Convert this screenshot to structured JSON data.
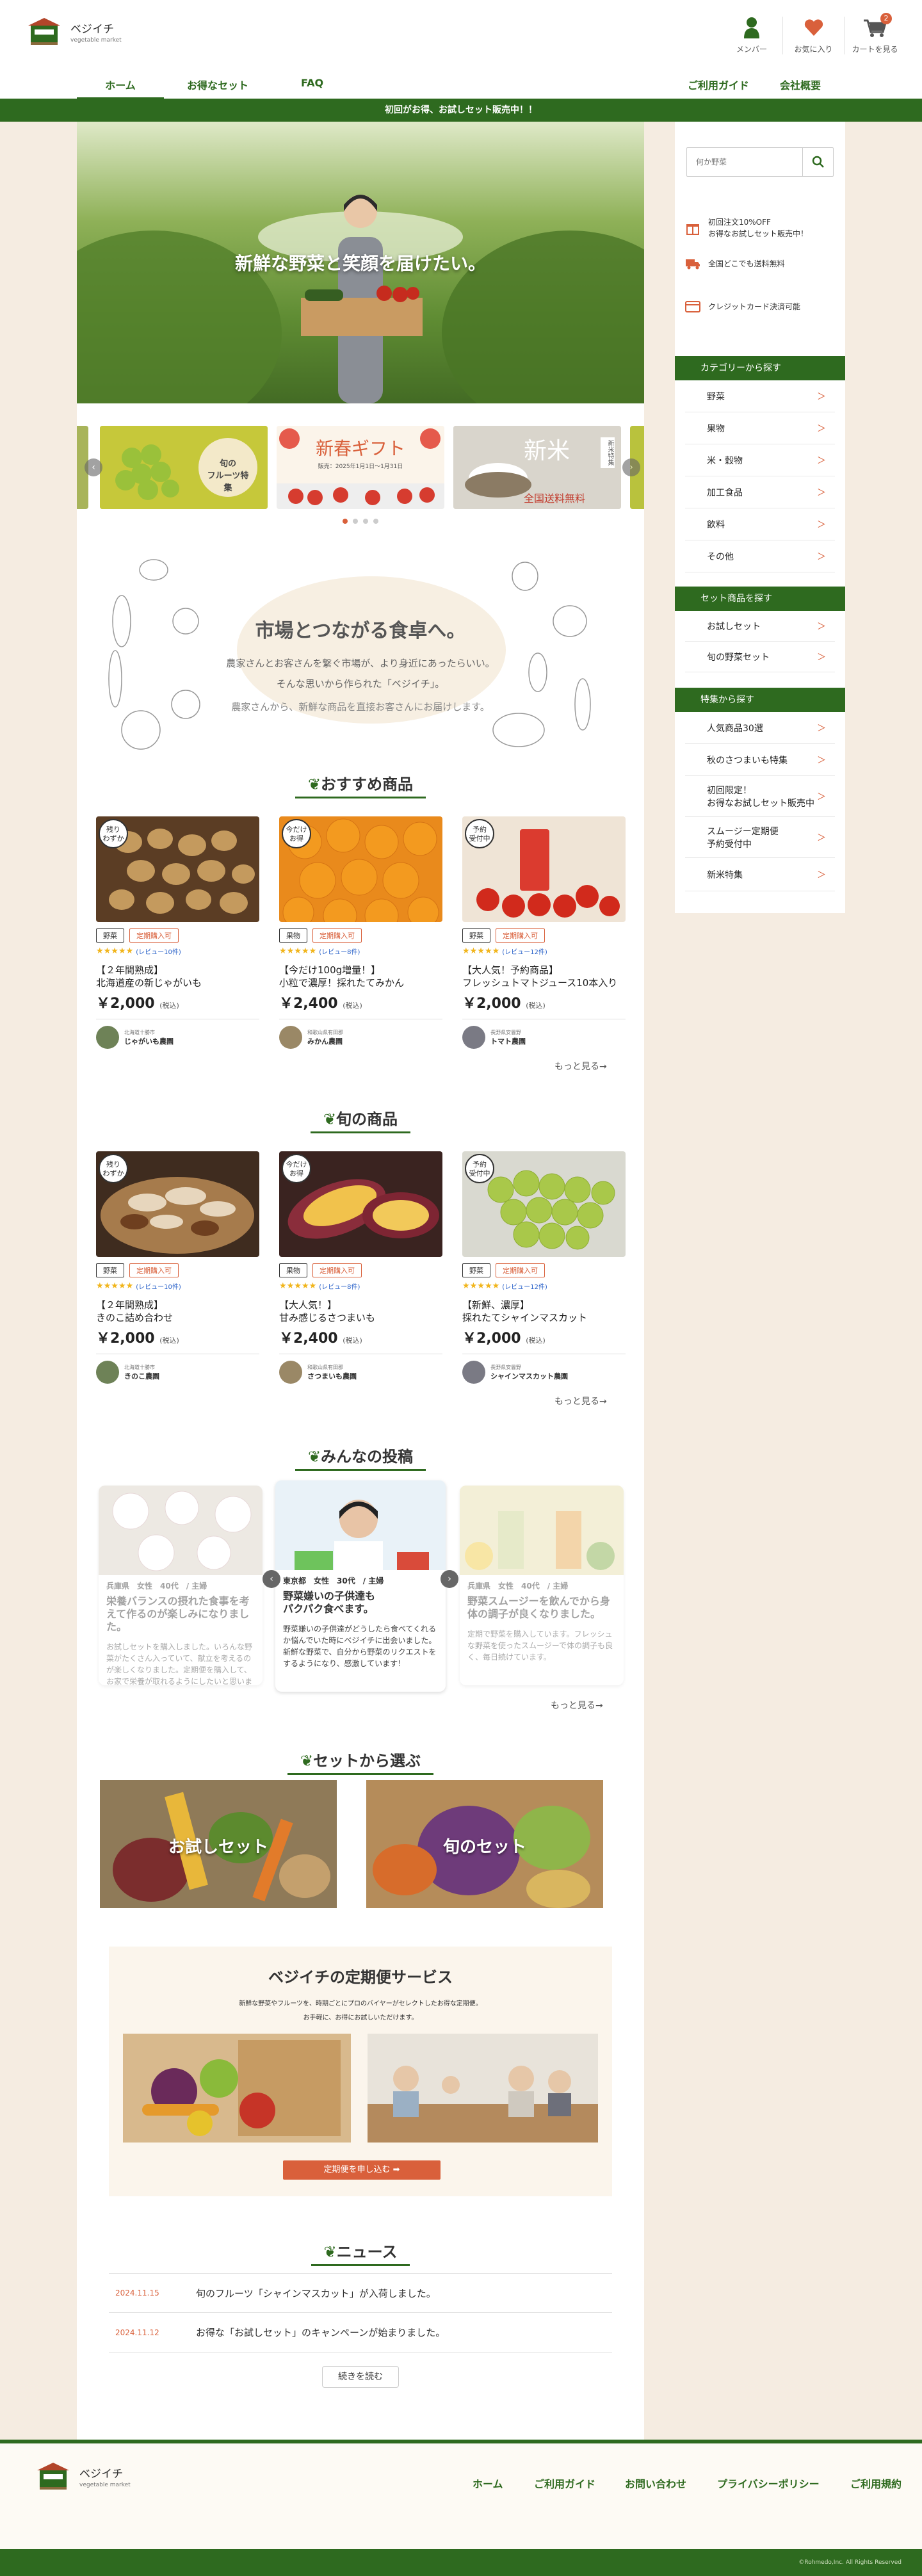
{
  "header": {
    "logo_name": "ベジイチ",
    "logo_sub": "vegetable market",
    "icons": [
      {
        "label": "メンバー",
        "icon": "member-icon"
      },
      {
        "label": "お気に入り",
        "icon": "heart-icon"
      },
      {
        "label": "カートを見る",
        "icon": "cart-icon",
        "badge": "2"
      }
    ]
  },
  "nav": {
    "home": "ホーム",
    "sets": "お得なセット",
    "faq": "FAQ",
    "guide": "ご利用ガイド",
    "company": "会社概要"
  },
  "banner": "初回がお得、お試しセット販売中！！",
  "hero": {
    "text": "新鮮な野菜と笑顔を届けたい。"
  },
  "slides": [
    {
      "label": "旬の\nフルーツ特集"
    },
    {
      "title": "新春ギフト",
      "sub": "販売：2025年1月1日～1月31日"
    },
    {
      "title": "新米",
      "sub": "全国送料無料",
      "side": "新米特集"
    }
  ],
  "intro": {
    "title": "市場とつながる食卓へ。",
    "lines": [
      "農家さんとお客さんを繋ぐ市場が、より身近にあったらいい。",
      "そんな思いから作られた「ベジイチ」。",
      "農家さんから、新鮮な商品を直接お客さんにお届けします。"
    ]
  },
  "recommended": {
    "title": "おすすめ商品",
    "more": "もっと見る→",
    "items": [
      {
        "badge": "残り\nわずか",
        "cat": "野菜",
        "tag": "定期購入可",
        "reviews": "(レビュー10件)",
        "name1": "【２年間熟成】",
        "name2": "北海道産の新じゃがいも",
        "price": "￥2,000",
        "tax": "(税込)",
        "seller_loc": "北海道十勝市",
        "seller": "じゃがいも農園"
      },
      {
        "badge": "今だけ\nお得",
        "cat": "果物",
        "tag": "定期購入可",
        "reviews": "(レビュー8件)",
        "name1": "【今だけ100g増量！】",
        "name2": "小粒で濃厚！採れたてみかん",
        "price": "￥2,400",
        "tax": "(税込)",
        "seller_loc": "和歌山県有田郡",
        "seller": "みかん農園"
      },
      {
        "badge": "予約\n受付中",
        "cat": "野菜",
        "tag": "定期購入可",
        "reviews": "(レビュー12件)",
        "name1": "【大人気！予約商品】",
        "name2": "フレッシュトマトジュース10本入り",
        "price": "￥2,000",
        "tax": "(税込)",
        "seller_loc": "長野県安曇野",
        "seller": "トマト農園"
      }
    ]
  },
  "seasonal": {
    "title": "旬の商品",
    "more": "もっと見る→",
    "items": [
      {
        "badge": "残り\nわずか",
        "cat": "野菜",
        "tag": "定期購入可",
        "reviews": "(レビュー10件)",
        "name1": "【２年間熟成】",
        "name2": "きのこ詰め合わせ",
        "price": "￥2,000",
        "tax": "(税込)",
        "seller_loc": "北海道十勝市",
        "seller": "きのこ農園"
      },
      {
        "badge": "今だけ\nお得",
        "cat": "果物",
        "tag": "定期購入可",
        "reviews": "(レビュー8件)",
        "name1": "【大人気！】",
        "name2": "甘み感じるさつまいも",
        "price": "￥2,400",
        "tax": "(税込)",
        "seller_loc": "和歌山県有田郡",
        "seller": "さつまいも農園"
      },
      {
        "badge": "予約\n受付中",
        "cat": "野菜",
        "tag": "定期購入可",
        "reviews": "(レビュー12件)",
        "name1": "【新鮮、濃厚】",
        "name2": "採れたてシャインマスカット",
        "price": "￥2,000",
        "tax": "(税込)",
        "seller_loc": "長野県安曇野",
        "seller": "シャインマスカット農園"
      }
    ]
  },
  "posts": {
    "title": "みんなの投稿",
    "more": "もっと見る→",
    "items": [
      {
        "meta": "兵庫県　女性　40代　/ 主婦",
        "title": "栄養バランスの摂れた食事を考えて作るのが楽しみになりました。",
        "body": "お試しセットを購入しました。いろんな野菜がたくさん入っていて、献立を考えるのが楽しくなりました。定期便を購入して、お家で栄養が取れるようにしたいと思います。"
      },
      {
        "meta": "東京都　女性　30代　/ 主婦",
        "title": "野菜嫌いの子供達も\nパクパク食べます。",
        "body": "野菜嫌いの子供達がどうしたら食べてくれるか悩んでいた時にベジイチに出会いました。新鮮な野菜で、自分から野菜のリクエストをするようになり、感激しています！"
      },
      {
        "meta": "兵庫県　女性　40代　/ 主婦",
        "title": "野菜スムージーを飲んでから身体の調子が良くなりました。",
        "body": "定期で野菜を購入しています。フレッシュな野菜を使ったスムージーで体の調子も良く、毎日続けています。"
      }
    ]
  },
  "sets": {
    "title": "セットから選ぶ",
    "items": [
      {
        "label": "お試しセット"
      },
      {
        "label": "旬のセット"
      }
    ]
  },
  "subscription": {
    "title": "ベジイチの定期便サービス",
    "line1": "新鮮な野菜やフルーツを、時期ごとにプロのバイヤーがセレクトしたお得な定期便。",
    "line2": "お手軽に、お得にお試しいただけます。",
    "button": "定期便を申し込む"
  },
  "news": {
    "title": "ニュース",
    "items": [
      {
        "date": "2024.11.15",
        "text": "旬のフルーツ「シャインマスカット」が入荷しました。"
      },
      {
        "date": "2024.11.12",
        "text": "お得な「お試しセット」のキャンペーンが始まりました。"
      }
    ],
    "read_all": "続きを読む"
  },
  "sidebar": {
    "search_placeholder": "何か野菜",
    "features": [
      {
        "icon": "gift-icon",
        "text": "初回注文10%OFF\nお得なお試しセット販売中！"
      },
      {
        "icon": "truck-icon",
        "text": "全国どこでも送料無料"
      },
      {
        "icon": "card-icon",
        "text": "クレジットカード決済可能"
      }
    ],
    "category_head": "カテゴリーから探す",
    "categories": [
      "野菜",
      "果物",
      "米・穀物",
      "加工食品",
      "飲料",
      "その他"
    ],
    "set_head": "セット商品を探す",
    "set_items": [
      "お試しセット",
      "旬の野菜セット"
    ],
    "feature_head": "特集から探す",
    "feature_items": [
      "人気商品30選",
      "秋のさつまいも特集",
      "初回限定！\nお得なお試しセット販売中",
      "スムージー定期便\n予約受付中",
      "新米特集"
    ]
  },
  "footer": {
    "links": [
      "ホーム",
      "ご利用ガイド",
      "お問い合わせ",
      "プライバシーポリシー",
      "ご利用規約"
    ],
    "copyright": "©Rohmedo,Inc. All Rights Reserved"
  },
  "colors": {
    "green": "#2e6a1f",
    "orange": "#d9603b",
    "cream": "#f5ece1"
  }
}
